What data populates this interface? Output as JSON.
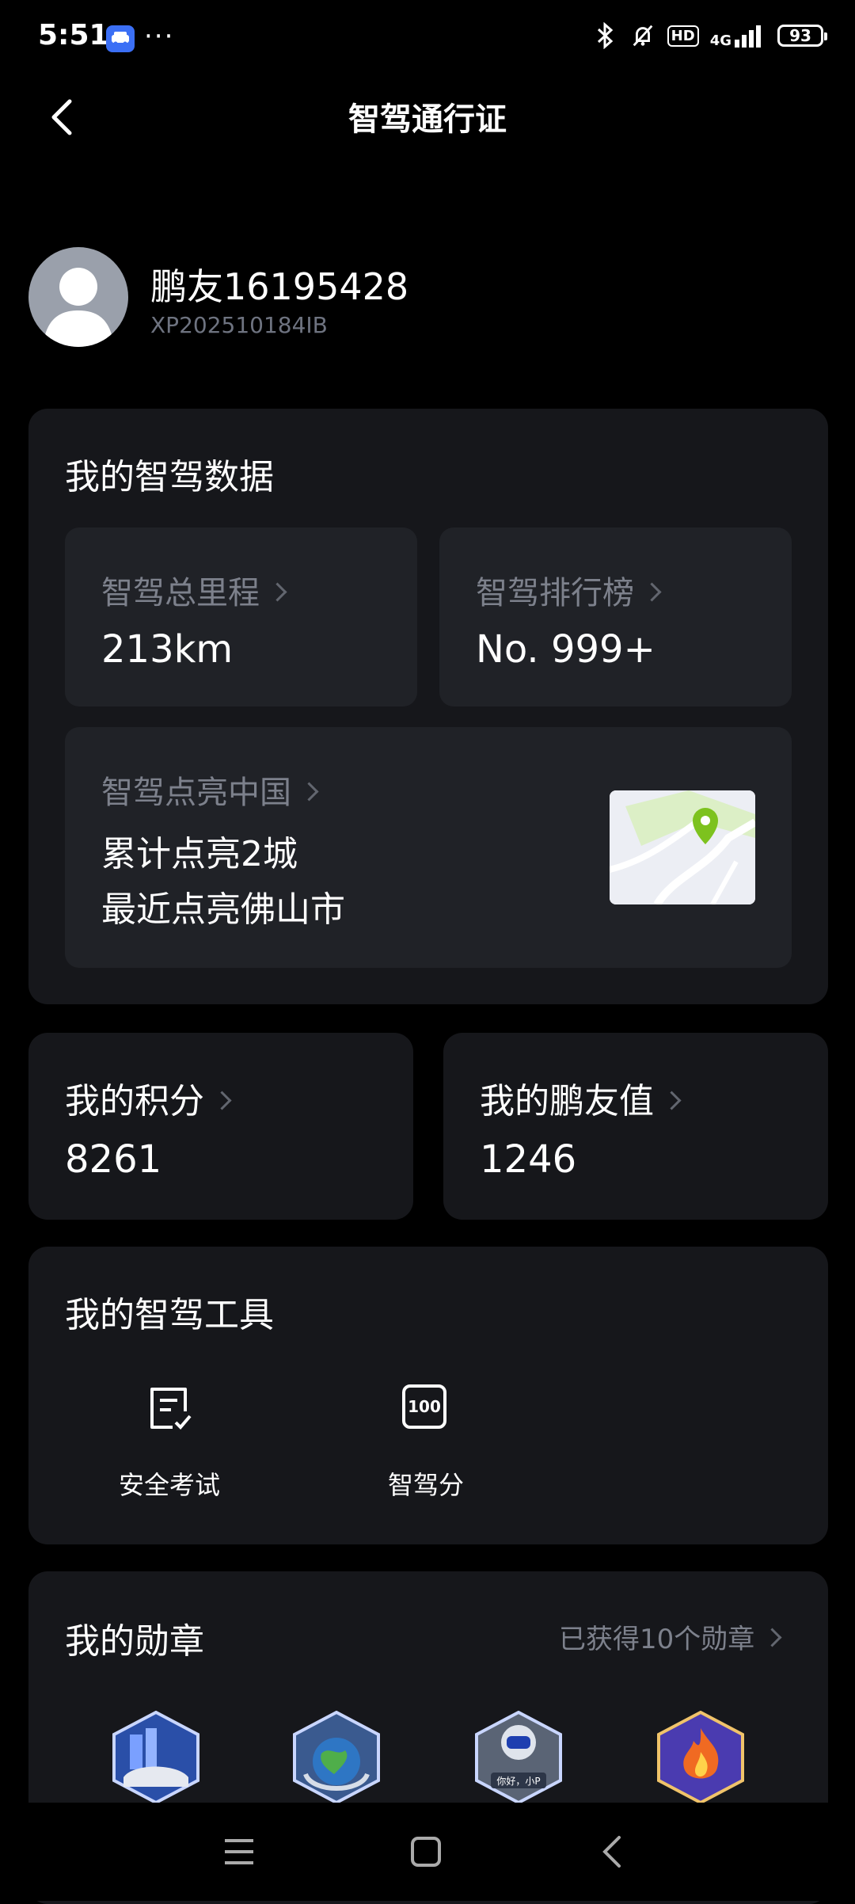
{
  "status_bar": {
    "time": "5:51",
    "more": "···",
    "hd": "HD",
    "network": "4G",
    "battery": "93"
  },
  "header": {
    "title": "智驾通行证"
  },
  "profile": {
    "name": "鹏友16195428",
    "id": "XP202510184IB"
  },
  "driving_data": {
    "title": "我的智驾数据",
    "mileage_label": "智驾总里程",
    "mileage_value": "213km",
    "ranking_label": "智驾排行榜",
    "ranking_value": "No. 999+",
    "light_label": "智驾点亮中国",
    "light_line1": "累计点亮2城",
    "light_line2": "最近点亮佛山市"
  },
  "points": {
    "label": "我的积分",
    "value": "8261"
  },
  "friend_value": {
    "label": "我的鹏友值",
    "value": "1246"
  },
  "tools": {
    "title": "我的智驾工具",
    "items": [
      {
        "label": "安全考试",
        "icon": "exam-checklist-icon"
      },
      {
        "label": "智驾分",
        "icon": "score-100-icon",
        "icon_text": "100"
      }
    ]
  },
  "medals": {
    "title": "我的勋章",
    "summary": "已获得10个勋章",
    "items": [
      {
        "icon": "car-city-medal-icon",
        "color": "#2a4fa8"
      },
      {
        "icon": "earth-medal-icon",
        "color": "#3a5a8f"
      },
      {
        "icon": "robot-medal-icon",
        "color": "#5a6475",
        "text": "你好，小P"
      },
      {
        "icon": "fire-medal-icon",
        "color": "#d24a1e"
      }
    ]
  },
  "colors": {
    "accent_green": "#7dc21e",
    "card_bg": "#16171b",
    "sub_card_bg": "#202227"
  }
}
